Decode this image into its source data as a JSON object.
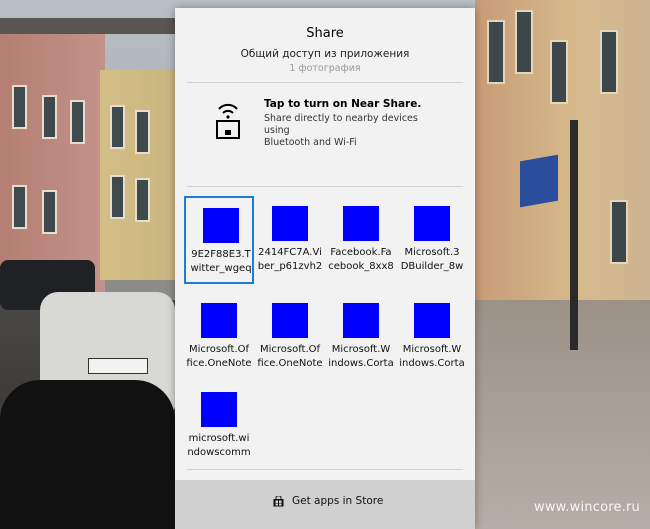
{
  "share": {
    "title": "Share",
    "subtitle": "Общий доступ из приложения",
    "count": "1 фотография",
    "near_share": {
      "title": "Tap to turn on Near Share.",
      "description_line1": "Share directly to nearby devices using",
      "description_line2": "Bluetooth and Wi-Fi",
      "icon": "near-share-icon"
    },
    "apps": [
      {
        "line1": "9E2F88E3.T",
        "line2": "witter_wgeq",
        "selected": true
      },
      {
        "line1": "2414FC7A.Vi",
        "line2": "ber_p61zvh2",
        "selected": false
      },
      {
        "line1": "Facebook.Fa",
        "line2": "cebook_8xx8",
        "selected": false
      },
      {
        "line1": "Microsoft.3",
        "line2": "DBuilder_8w",
        "selected": false
      },
      {
        "line1": "Microsoft.Of",
        "line2": "fice.OneNote",
        "selected": false
      },
      {
        "line1": "Microsoft.Of",
        "line2": "fice.OneNote",
        "selected": false
      },
      {
        "line1": "Microsoft.W",
        "line2": "indows.Corta",
        "selected": false
      },
      {
        "line1": "Microsoft.W",
        "line2": "indows.Corta",
        "selected": false
      },
      {
        "line1": "microsoft.wi",
        "line2": "ndowscomm",
        "selected": false
      }
    ],
    "store_button": {
      "label": "Get apps in Store",
      "icon": "store-icon"
    },
    "colors": {
      "tile": "#0000ff",
      "selection": "#1a7fd4",
      "panel": "#f2f2f2"
    }
  },
  "watermark": "www.wincore.ru"
}
